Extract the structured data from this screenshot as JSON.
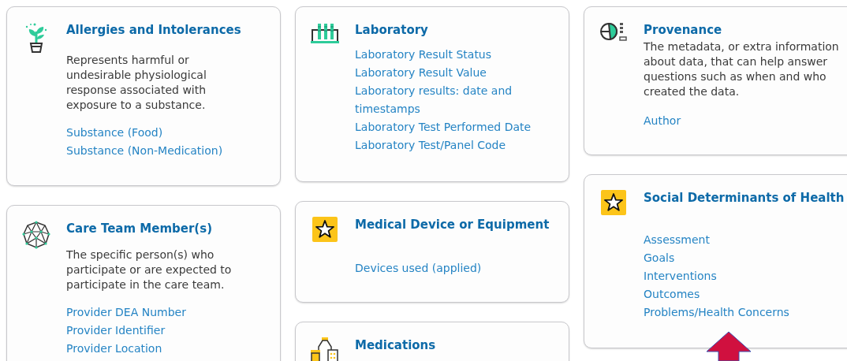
{
  "columns": [
    {
      "cards": [
        {
          "kind": "plant",
          "title": "Allergies and Intolerances",
          "description": "Represents harmful or undesirable physiological response associated with exposure to a substance.",
          "links": [
            "Substance (Food)",
            "Substance (Non-Medication)"
          ]
        },
        {
          "kind": "network",
          "title": "Care Team Member(s)",
          "description": "The specific person(s) who participate or are expected to participate in the care team.",
          "links": [
            "Provider DEA Number",
            "Provider Identifier",
            "Provider Location"
          ]
        }
      ]
    },
    {
      "cards": [
        {
          "kind": "test-tubes",
          "title": "Laboratory",
          "links": [
            "Laboratory Result Status",
            "Laboratory Result Value",
            "Laboratory results: date and timestamps",
            "Laboratory Test Performed Date",
            "Laboratory Test/Panel Code"
          ]
        },
        {
          "kind": "star",
          "title": "Medical Device or Equipment",
          "links": [
            "Devices used (applied)"
          ]
        },
        {
          "kind": "medicine",
          "title": "Medications"
        }
      ]
    },
    {
      "cards": [
        {
          "kind": "chart-list",
          "title": "Provenance",
          "description": "The metadata, or extra information about data, that can help answer questions such as when and who created the data.",
          "links": [
            "Author"
          ]
        },
        {
          "kind": "star",
          "title": "Social Determinants of Health",
          "links": [
            "Assessment",
            "Goals",
            "Interventions",
            "Outcomes",
            "Problems/Health Concerns"
          ]
        }
      ]
    }
  ]
}
